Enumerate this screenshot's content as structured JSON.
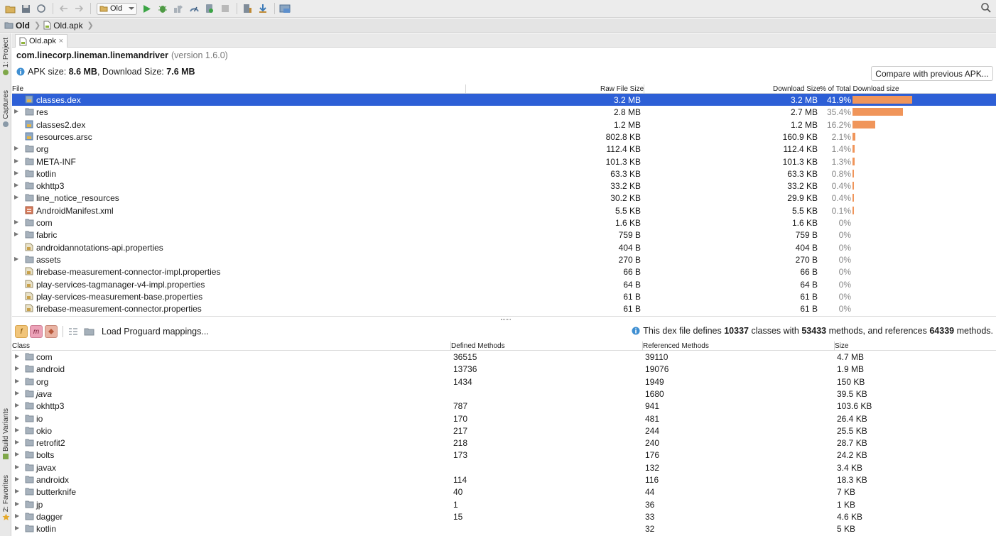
{
  "toolbar": {
    "config": "Old"
  },
  "breadcrumb": [
    "Old",
    "Old.apk"
  ],
  "tab": {
    "label": "Old.apk"
  },
  "side_tabs": {
    "project": "1: Project",
    "captures": "Captures",
    "build_variants": "Build Variants",
    "favorites": "2: Favorites"
  },
  "apk": {
    "package": "com.linecorp.lineman.linemandriver",
    "version": "(version 1.6.0)",
    "apk_size_label": "APK size:",
    "apk_size": "8.6 MB",
    "download_size_label": ", Download Size:",
    "download_size": "7.6 MB",
    "compare_button": "Compare with previous APK..."
  },
  "file_table": {
    "headers": {
      "file": "File",
      "raw": "Raw File Size",
      "download": "Download Size",
      "percent": "% of Total Download size"
    },
    "rows": [
      {
        "name": "classes.dex",
        "expandable": false,
        "icon": "dex-icon",
        "raw": "3.2 MB",
        "download": "3.2 MB",
        "percent": "41.9%",
        "fraction": 0.419
      },
      {
        "name": "res",
        "expandable": true,
        "icon": "folder-icon",
        "raw": "2.8 MB",
        "download": "2.7 MB",
        "percent": "35.4%",
        "fraction": 0.354
      },
      {
        "name": "classes2.dex",
        "expandable": false,
        "icon": "dex-icon",
        "raw": "1.2 MB",
        "download": "1.2 MB",
        "percent": "16.2%",
        "fraction": 0.162
      },
      {
        "name": "resources.arsc",
        "expandable": false,
        "icon": "dex-icon",
        "raw": "802.8 KB",
        "download": "160.9 KB",
        "percent": "2.1%",
        "fraction": 0.021
      },
      {
        "name": "org",
        "expandable": true,
        "icon": "folder-icon",
        "raw": "112.4 KB",
        "download": "112.4 KB",
        "percent": "1.4%",
        "fraction": 0.014
      },
      {
        "name": "META-INF",
        "expandable": true,
        "icon": "folder-icon",
        "raw": "101.3 KB",
        "download": "101.3 KB",
        "percent": "1.3%",
        "fraction": 0.013
      },
      {
        "name": "kotlin",
        "expandable": true,
        "icon": "folder-icon",
        "raw": "63.3 KB",
        "download": "63.3 KB",
        "percent": "0.8%",
        "fraction": 0.008
      },
      {
        "name": "okhttp3",
        "expandable": true,
        "icon": "folder-icon",
        "raw": "33.2 KB",
        "download": "33.2 KB",
        "percent": "0.4%",
        "fraction": 0.004
      },
      {
        "name": "line_notice_resources",
        "expandable": true,
        "icon": "folder-icon",
        "raw": "30.2 KB",
        "download": "29.9 KB",
        "percent": "0.4%",
        "fraction": 0.004
      },
      {
        "name": "AndroidManifest.xml",
        "expandable": false,
        "icon": "manifest-icon",
        "raw": "5.5 KB",
        "download": "5.5 KB",
        "percent": "0.1%",
        "fraction": 0.001
      },
      {
        "name": "com",
        "expandable": true,
        "icon": "folder-icon",
        "raw": "1.6 KB",
        "download": "1.6 KB",
        "percent": "0%",
        "fraction": 0
      },
      {
        "name": "fabric",
        "expandable": true,
        "icon": "folder-icon",
        "raw": "759 B",
        "download": "759 B",
        "percent": "0%",
        "fraction": 0
      },
      {
        "name": "androidannotations-api.properties",
        "expandable": false,
        "icon": "properties-icon",
        "raw": "404 B",
        "download": "404 B",
        "percent": "0%",
        "fraction": 0
      },
      {
        "name": "assets",
        "expandable": true,
        "icon": "folder-icon",
        "raw": "270 B",
        "download": "270 B",
        "percent": "0%",
        "fraction": 0
      },
      {
        "name": "firebase-measurement-connector-impl.properties",
        "expandable": false,
        "icon": "properties-icon",
        "raw": "66 B",
        "download": "66 B",
        "percent": "0%",
        "fraction": 0
      },
      {
        "name": "play-services-tagmanager-v4-impl.properties",
        "expandable": false,
        "icon": "properties-icon",
        "raw": "64 B",
        "download": "64 B",
        "percent": "0%",
        "fraction": 0
      },
      {
        "name": "play-services-measurement-base.properties",
        "expandable": false,
        "icon": "properties-icon",
        "raw": "61 B",
        "download": "61 B",
        "percent": "0%",
        "fraction": 0
      },
      {
        "name": "firebase-measurement-connector.properties",
        "expandable": false,
        "icon": "properties-icon",
        "raw": "61 B",
        "download": "61 B",
        "percent": "0%",
        "fraction": 0
      }
    ]
  },
  "dex_toolbar": {
    "filter_f": "f",
    "filter_m": "m",
    "load_proguard": "Load Proguard mappings...",
    "info_prefix": "This dex file defines ",
    "classes": "10337",
    "mid1": " classes with ",
    "methods": "53433",
    "mid2": " methods, and references ",
    "references": "64339",
    "suffix": " methods."
  },
  "class_table": {
    "headers": {
      "class": "Class",
      "defined": "Defined Methods",
      "referenced": "Referenced Methods",
      "size": "Size"
    },
    "rows": [
      {
        "name": "com",
        "italic": false,
        "defined": "36515",
        "referenced": "39110",
        "size": "4.7 MB"
      },
      {
        "name": "android",
        "italic": false,
        "defined": "13736",
        "referenced": "19076",
        "size": "1.9 MB"
      },
      {
        "name": "org",
        "italic": false,
        "defined": "1434",
        "referenced": "1949",
        "size": "150 KB"
      },
      {
        "name": "java",
        "italic": true,
        "defined": "",
        "referenced": "1680",
        "size": "39.5 KB"
      },
      {
        "name": "okhttp3",
        "italic": false,
        "defined": "787",
        "referenced": "941",
        "size": "103.6 KB"
      },
      {
        "name": "io",
        "italic": false,
        "defined": "170",
        "referenced": "481",
        "size": "26.4 KB"
      },
      {
        "name": "okio",
        "italic": false,
        "defined": "217",
        "referenced": "244",
        "size": "25.5 KB"
      },
      {
        "name": "retrofit2",
        "italic": false,
        "defined": "218",
        "referenced": "240",
        "size": "28.7 KB"
      },
      {
        "name": "bolts",
        "italic": false,
        "defined": "173",
        "referenced": "176",
        "size": "24.2 KB"
      },
      {
        "name": "javax",
        "italic": false,
        "defined": "",
        "referenced": "132",
        "size": "3.4 KB"
      },
      {
        "name": "androidx",
        "italic": false,
        "defined": "114",
        "referenced": "116",
        "size": "18.3 KB"
      },
      {
        "name": "butterknife",
        "italic": false,
        "defined": "40",
        "referenced": "44",
        "size": "7 KB"
      },
      {
        "name": "jp",
        "italic": false,
        "defined": "1",
        "referenced": "36",
        "size": "1 KB"
      },
      {
        "name": "dagger",
        "italic": false,
        "defined": "15",
        "referenced": "33",
        "size": "4.6 KB"
      },
      {
        "name": "kotlin",
        "italic": false,
        "defined": "",
        "referenced": "32",
        "size": "5 KB"
      }
    ]
  },
  "colors": {
    "selection": "#2d5fd6",
    "bar": "#f0955a",
    "folder": "#9aa7b4"
  }
}
